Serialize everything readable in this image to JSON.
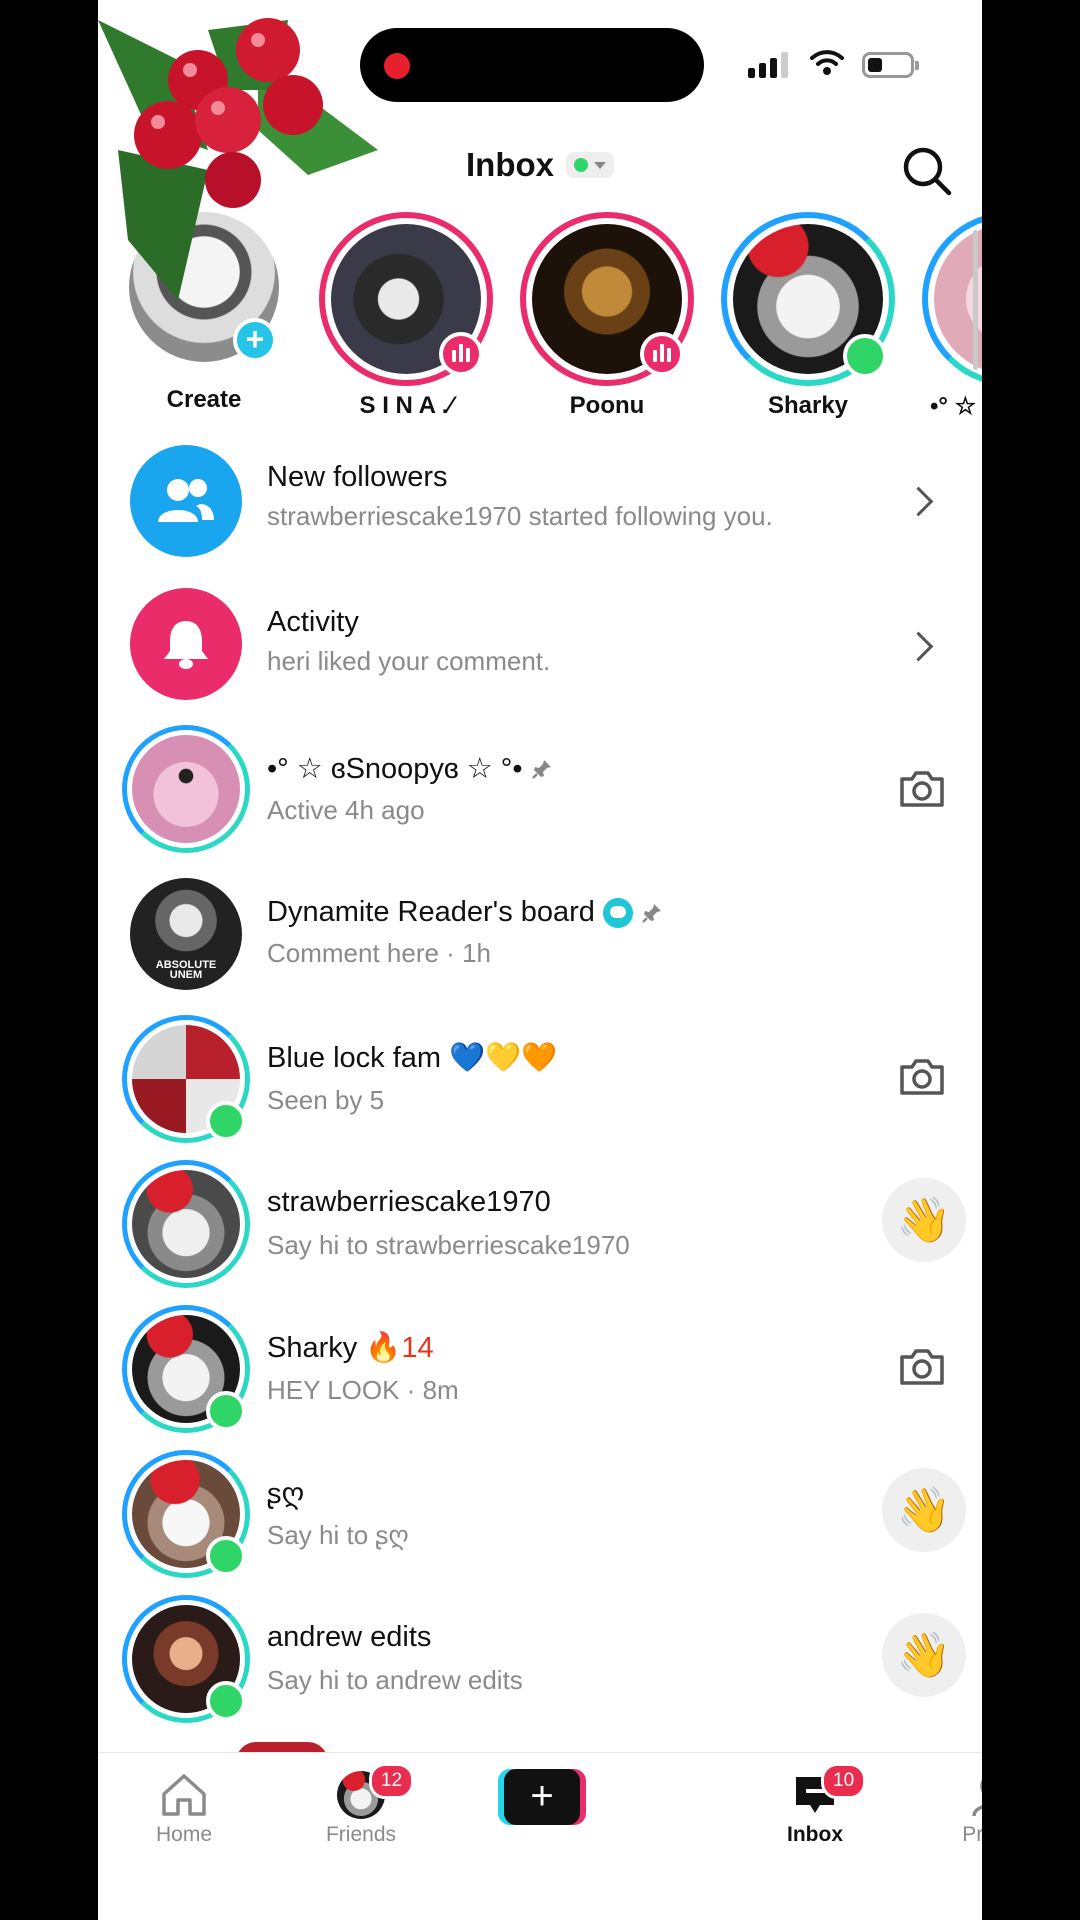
{
  "header": {
    "title": "Inbox"
  },
  "stories": [
    {
      "name": "Create"
    },
    {
      "name": "S I N A .⁄"
    },
    {
      "name": "Poonu"
    },
    {
      "name": "Sharky"
    },
    {
      "name": "•° ☆ ɞ"
    }
  ],
  "rows": [
    {
      "title": "New followers",
      "subtitle": "strawberriescake1970 started following you."
    },
    {
      "title": "Activity",
      "subtitle": "heri liked your comment."
    },
    {
      "title": "•° ☆ ɞSnoopyɞ ☆ °•",
      "subtitle": "Active 4h ago"
    },
    {
      "title": "Dynamite Reader's board",
      "subtitle": "Comment here · 1h"
    },
    {
      "title": "Blue lock fam 💙💛🧡",
      "subtitle": "Seen by 5"
    },
    {
      "title": "strawberriescake1970",
      "subtitle": "Say hi to strawberriescake1970"
    },
    {
      "title": "Sharky",
      "streak": "🔥14",
      "subtitle": "HEY LOOK · 8m"
    },
    {
      "title": "ʂღ",
      "subtitle": "Say hi to ʂღ"
    },
    {
      "title": "andrew edits",
      "subtitle": "Say hi to andrew edits"
    }
  ],
  "avatar_text": "ABSOLUTE\nUNEM",
  "tabs": [
    {
      "label": "Home"
    },
    {
      "label": "Friends",
      "badge": "12"
    },
    {
      "label": ""
    },
    {
      "label": "Inbox",
      "badge": "10"
    },
    {
      "label": "Profile"
    }
  ],
  "colors": {
    "accent": "#ea2c6a",
    "online": "#2fd566",
    "ring": "#1fa2ff",
    "teal": "#2ad8c5"
  }
}
